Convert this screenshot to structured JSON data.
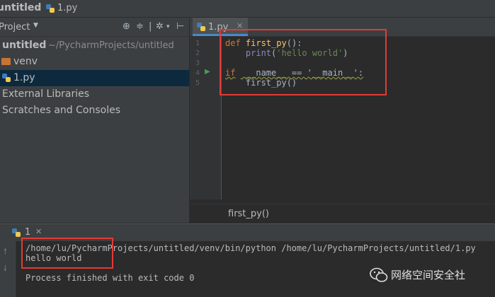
{
  "breadcrumb": {
    "project": "untitled",
    "file": "1.py"
  },
  "project_panel": {
    "title": "Project",
    "tree": [
      {
        "label": "untitled",
        "path": "~/PycharmProjects/untitled"
      },
      {
        "label": "venv"
      },
      {
        "label": "1.py"
      },
      {
        "label": "External Libraries"
      },
      {
        "label": "Scratches and Consoles"
      }
    ]
  },
  "editor": {
    "tab": "1.py",
    "line_numbers": [
      "1",
      "2",
      "3",
      "4",
      "5"
    ],
    "breadcrumb": "first_py()"
  },
  "run": {
    "tab": "1",
    "command": "/home/lu/PycharmProjects/untitled/venv/bin/python /home/lu/PycharmProjects/untitled/1.py",
    "output": "hello world",
    "exit": "Process finished with exit code 0"
  },
  "watermark": "网络空间安全社",
  "colors": {
    "highlight": "#e53935",
    "selection": "#0d293e",
    "tab_accent": "#4a88c7"
  }
}
